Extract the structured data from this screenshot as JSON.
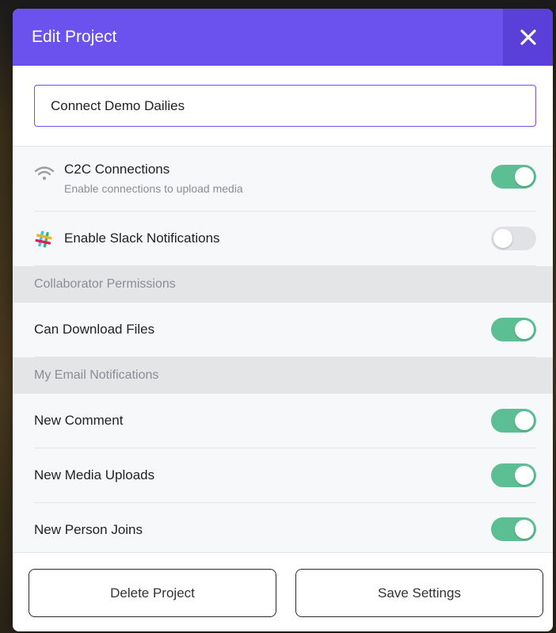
{
  "modal": {
    "title": "Edit Project",
    "close_icon": "close-icon",
    "project_name_value": "Connect Demo Dailies"
  },
  "settings": {
    "c2c": {
      "label": "C2C Connections",
      "sublabel": "Enable connections to upload media",
      "icon": "wifi-icon",
      "enabled": true
    },
    "slack": {
      "label": "Enable Slack Notifications",
      "icon": "slack-icon",
      "enabled": false
    }
  },
  "collaborator_permissions": {
    "title": "Collaborator Permissions",
    "can_download": {
      "label": "Can Download Files",
      "enabled": true
    }
  },
  "email_notifications": {
    "title": "My Email Notifications",
    "new_comment": {
      "label": "New Comment",
      "enabled": true
    },
    "new_media": {
      "label": "New Media Uploads",
      "enabled": true
    },
    "new_person": {
      "label": "New Person Joins",
      "enabled": true
    }
  },
  "footer": {
    "delete_label": "Delete Project",
    "save_label": "Save Settings"
  },
  "colors": {
    "header": "#6b52ee",
    "close_bg": "#5a3fd9",
    "toggle_on": "#5cbf93",
    "toggle_off": "#e1e2e5"
  }
}
